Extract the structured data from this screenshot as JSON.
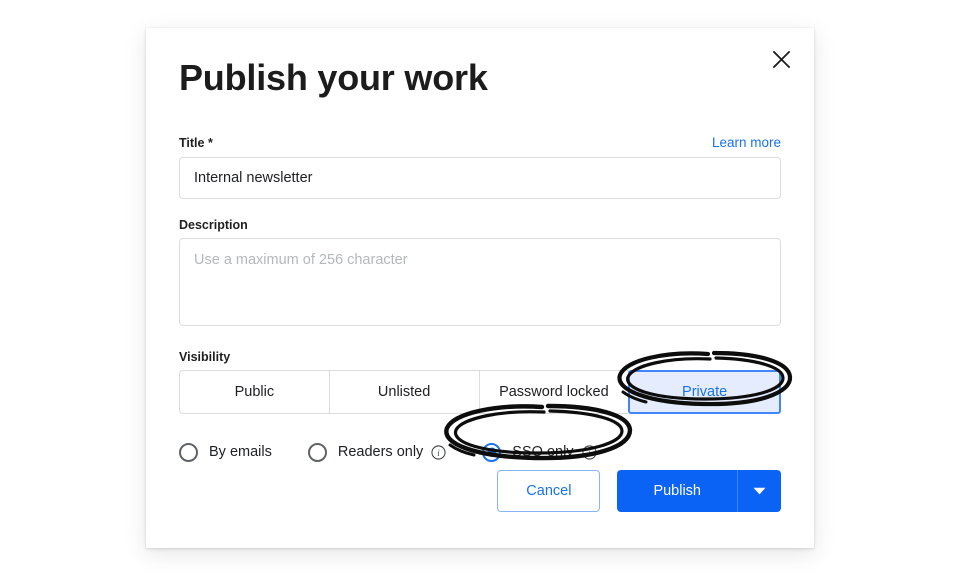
{
  "dialog": {
    "title": "Publish your work",
    "close_icon": "close-icon"
  },
  "form": {
    "title_field": {
      "label": "Title *",
      "value": "Internal newsletter",
      "placeholder": ""
    },
    "learn_more_link": "Learn more",
    "description_field": {
      "label": "Description",
      "value": "",
      "placeholder": "Use a maximum of 256 character"
    },
    "visibility": {
      "label": "Visibility",
      "options": [
        {
          "label": "Public",
          "selected": false
        },
        {
          "label": "Unlisted",
          "selected": false
        },
        {
          "label": "Password locked",
          "selected": false
        },
        {
          "label": "Private",
          "selected": true
        }
      ]
    },
    "access": {
      "options": [
        {
          "label": "By emails",
          "selected": false,
          "info": false
        },
        {
          "label": "Readers only",
          "selected": false,
          "info": true
        },
        {
          "label": "SSO only",
          "selected": true,
          "info": true
        }
      ]
    }
  },
  "footer": {
    "cancel_label": "Cancel",
    "publish_label": "Publish",
    "dropdown_icon": "chevron-down-icon"
  },
  "annotations": [
    {
      "name": "ellipse-around-private",
      "target": "Private"
    },
    {
      "name": "ellipse-around-sso-only",
      "target": "SSO only"
    }
  ],
  "colors": {
    "accent_blue": "#1a73e8",
    "publish_blue": "#0b63f6",
    "selected_segment_bg": "#e4ecfd",
    "selected_segment_border": "#4285f4",
    "border_gray": "#dadce0",
    "annotation_ink": "#0d0d0d"
  }
}
